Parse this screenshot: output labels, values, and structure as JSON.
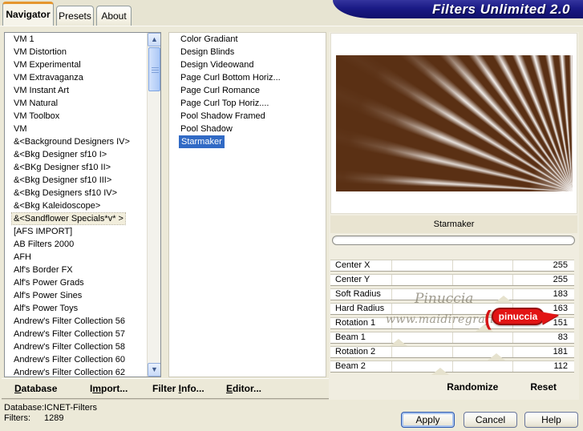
{
  "window": {
    "banner_title": "Filters Unlimited 2.0"
  },
  "tabs": {
    "items": [
      {
        "label": "Navigator",
        "active": true
      },
      {
        "label": "Presets",
        "active": false
      },
      {
        "label": "About",
        "active": false
      }
    ]
  },
  "category_list": {
    "selected_index": 14,
    "items": [
      "VM 1",
      "VM Distortion",
      "VM Experimental",
      "VM Extravaganza",
      "VM Instant Art",
      "VM Natural",
      "VM Toolbox",
      "VM",
      "&<Background Designers IV>",
      "&<Bkg Designer sf10 I>",
      "&<BKg Designer sf10 II>",
      "&<Bkg Designer sf10 III>",
      "&<Bkg Designers sf10 IV>",
      "&<Bkg Kaleidoscope>",
      "&<Sandflower Specials*v* >",
      "[AFS IMPORT]",
      "AB Filters 2000",
      "AFH",
      "Alf's Border FX",
      "Alf's Power Grads",
      "Alf's Power Sines",
      "Alf's Power Toys",
      "Andrew's Filter Collection 56",
      "Andrew's Filter Collection 57",
      "Andrew's Filter Collection 58",
      "Andrew's Filter Collection 60",
      "Andrew's Filter Collection 62"
    ]
  },
  "filter_list": {
    "selected_index": 8,
    "items": [
      "Color Gradiant",
      "Design Blinds",
      "Design Videowand",
      "Page Curl Bottom Horiz...",
      "Page Curl Romance",
      "Page Curl Top Horiz....",
      "Pool Shadow Framed",
      "Pool Shadow",
      "Starmaker"
    ]
  },
  "preview": {
    "caption": "Starmaker",
    "progress_percent": 0
  },
  "parameters": {
    "rows": [
      {
        "label": "Center X",
        "value": "255",
        "thumb": null
      },
      {
        "label": "Center Y",
        "value": "255",
        "thumb": null
      },
      {
        "label": "Soft Radius",
        "value": "183",
        "thumb": 0.71
      },
      {
        "label": "Hard Radius",
        "value": "163",
        "thumb": 0.66
      },
      {
        "label": "Rotation 1",
        "value": "151",
        "thumb": 0.63
      },
      {
        "label": "Beam 1",
        "value": "83",
        "thumb": 0.28
      },
      {
        "label": "Rotation 2",
        "value": "181",
        "thumb": 0.68
      },
      {
        "label": "Beam 2",
        "value": "112",
        "thumb": 0.45
      }
    ]
  },
  "actions": {
    "randomize": "Randomize",
    "reset": "Reset"
  },
  "menu": {
    "items": [
      {
        "pre": "",
        "key": "D",
        "post": "atabase"
      },
      {
        "pre": "I",
        "key": "m",
        "post": "port..."
      },
      {
        "pre": "Filter ",
        "key": "I",
        "post": "nfo..."
      },
      {
        "pre": "",
        "key": "E",
        "post": "ditor..."
      }
    ]
  },
  "status": {
    "database_label": "Database:",
    "database_value": "ICNET-Filters",
    "filters_label": "Filters:",
    "filters_value": "1289"
  },
  "dialog_buttons": {
    "apply": "Apply",
    "cancel": "Cancel",
    "help": "Help"
  },
  "watermark": {
    "line1": "Pinuccia",
    "line2": "www.maidiregrafica.eu",
    "stamp_text": "pinuccia"
  },
  "colors": {
    "background": "#ece9d8",
    "banner": "#15157c",
    "selection_blue": "#316ac5",
    "preview_brown": "#5a3014",
    "ray_white": "#ffffff",
    "stamp_red": "#e21414",
    "tab_accent_orange": "#e5962e"
  }
}
